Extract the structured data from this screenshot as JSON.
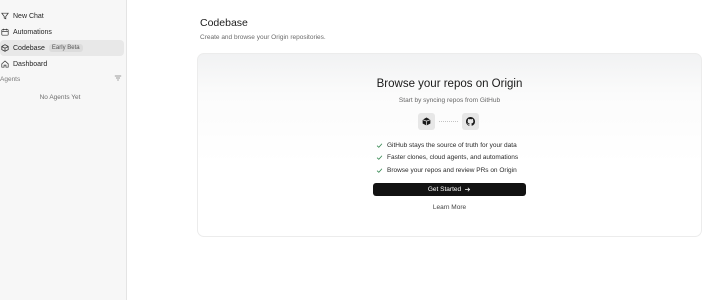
{
  "sidebar": {
    "items": [
      {
        "label": "New Chat",
        "icon": "filter-funnel-icon"
      },
      {
        "label": "Automations",
        "icon": "calendar-icon"
      },
      {
        "label": "Codebase",
        "icon": "cube-icon",
        "badge": "Early Beta",
        "active": true
      },
      {
        "label": "Dashboard",
        "icon": "home-icon"
      }
    ],
    "agents_header": "Agents",
    "agents_empty": "No Agents Yet"
  },
  "main": {
    "title": "Codebase",
    "subtitle": "Create and browse your Origin repositories.",
    "card": {
      "title": "Browse your repos on Origin",
      "subtitle": "Start by syncing repos from GitHub",
      "benefits": [
        "GitHub stays the source of truth for your data",
        "Faster clones, cloud agents, and automations",
        "Browse your repos and review PRs on Origin"
      ],
      "cta_label": "Get Started",
      "learn_more_label": "Learn More"
    }
  },
  "colors": {
    "sidebar_bg": "#f7f7f7",
    "active_item_bg": "#e8e8e8",
    "primary_button": "#121212",
    "check_green": "#3a8a55"
  }
}
